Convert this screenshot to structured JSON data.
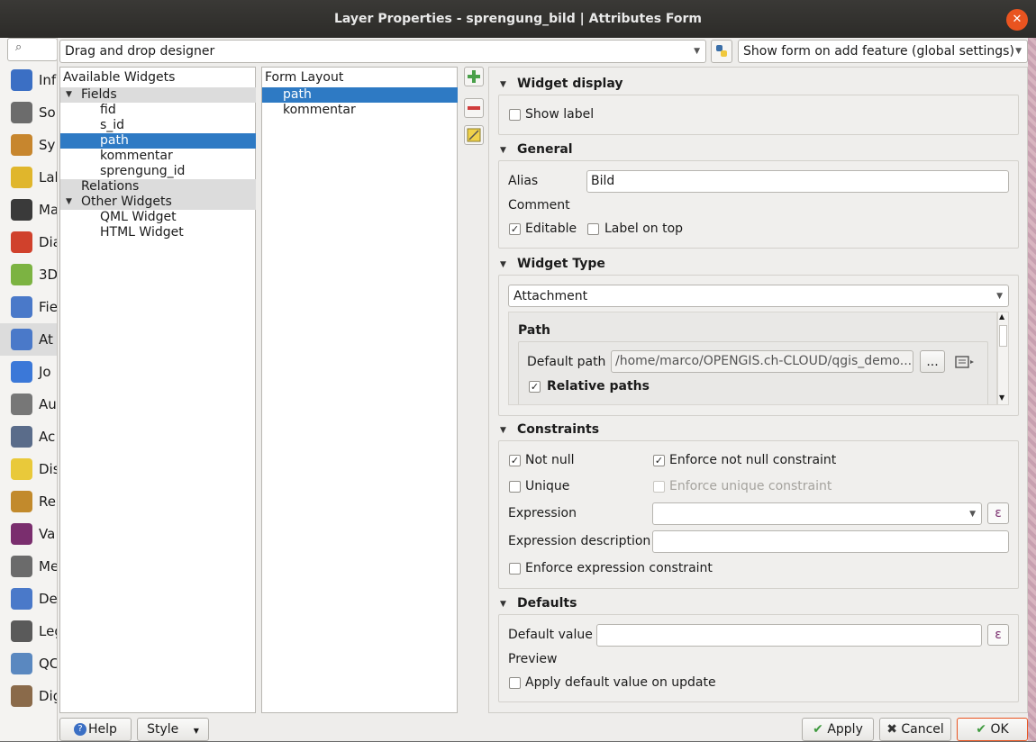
{
  "window": {
    "title": "Layer Properties - sprengung_bild | Attributes Form",
    "close_icon": "close-icon"
  },
  "sidebar": {
    "search_icon": "search-icon",
    "items": [
      {
        "label": "Inf",
        "icon": "information-icon",
        "color": "#3b6fc4"
      },
      {
        "label": "So",
        "icon": "source-icon",
        "color": "#6c6c6c"
      },
      {
        "label": "Sy",
        "icon": "symbology-icon",
        "color": "#c7862e"
      },
      {
        "label": "Lal",
        "icon": "labels-icon",
        "color": "#e0b62c"
      },
      {
        "label": "Ma",
        "icon": "masks-icon",
        "color": "#3a3a3a"
      },
      {
        "label": "Dia",
        "icon": "diagrams-icon",
        "color": "#d0412c"
      },
      {
        "label": "3D",
        "icon": "3d-view-icon",
        "color": "#7cb342"
      },
      {
        "label": "Fie",
        "icon": "fields-icon",
        "color": "#4a79c9"
      },
      {
        "label": "At",
        "icon": "attributes-form-icon",
        "color": "#4a79c9"
      },
      {
        "label": "Jo",
        "icon": "joins-icon",
        "color": "#3b78d8"
      },
      {
        "label": "Au",
        "icon": "auxiliary-storage-icon",
        "color": "#777777"
      },
      {
        "label": "Ac",
        "icon": "actions-icon",
        "color": "#5a6c8a"
      },
      {
        "label": "Dis",
        "icon": "display-icon",
        "color": "#e9c93a"
      },
      {
        "label": "Re",
        "icon": "rendering-icon",
        "color": "#c28a2c"
      },
      {
        "label": "Va",
        "icon": "variables-icon",
        "color": "#7a2e6e"
      },
      {
        "label": "Me",
        "icon": "metadata-icon",
        "color": "#6b6b6b"
      },
      {
        "label": "De",
        "icon": "dependencies-icon",
        "color": "#4a79c9"
      },
      {
        "label": "Leg",
        "icon": "legend-icon",
        "color": "#5a5a5a"
      },
      {
        "label": "QC",
        "icon": "qgis-server-icon",
        "color": "#5a88c0"
      },
      {
        "label": "Dig",
        "icon": "digitizing-icon",
        "color": "#8a6a4a"
      }
    ]
  },
  "toolbar": {
    "designer_combo": "Drag and drop designer",
    "python_icon": "python-icon",
    "show_form_combo": "Show form on add feature (global settings)"
  },
  "available_widgets": {
    "header": "Available Widgets",
    "fields_group": "Fields",
    "fields": [
      "fid",
      "s_id",
      "path",
      "kommentar",
      "sprengung_id"
    ],
    "relations_group": "Relations",
    "other_group": "Other Widgets",
    "other": [
      "QML Widget",
      "HTML Widget"
    ]
  },
  "form_layout": {
    "header": "Form Layout",
    "items": [
      "path",
      "kommentar"
    ]
  },
  "layout_tools": {
    "add_icon": "add-icon",
    "remove_icon": "remove-icon",
    "edit_icon": "edit-icon"
  },
  "widget_display": {
    "title": "Widget display",
    "show_label": "Show label"
  },
  "general": {
    "title": "General",
    "alias_label": "Alias",
    "alias_value": "Bild",
    "comment_label": "Comment",
    "editable": "Editable",
    "label_on_top": "Label on top"
  },
  "widget_type": {
    "title": "Widget Type",
    "type_value": "Attachment",
    "path_title": "Path",
    "default_path_label": "Default path",
    "default_path_value": "/home/marco/OPENGIS.ch-CLOUD/qgis_demo...",
    "browse_label": "...",
    "relative_paths": "Relative paths"
  },
  "constraints": {
    "title": "Constraints",
    "not_null": "Not null",
    "enforce_not_null": "Enforce not null constraint",
    "unique": "Unique",
    "enforce_unique": "Enforce unique constraint",
    "expression_label": "Expression",
    "expression_desc_label": "Expression description",
    "enforce_expression": "Enforce expression constraint"
  },
  "defaults": {
    "title": "Defaults",
    "default_value_label": "Default value",
    "preview_label": "Preview",
    "apply_on_update": "Apply default value on update"
  },
  "footer": {
    "help": "Help",
    "style": "Style",
    "apply": "Apply",
    "cancel": "Cancel",
    "ok": "OK"
  }
}
